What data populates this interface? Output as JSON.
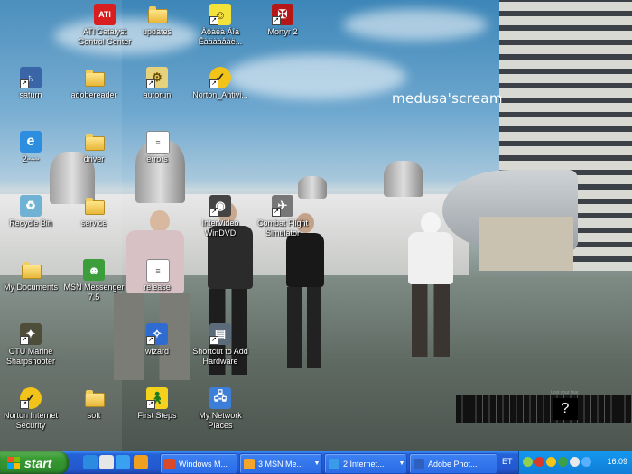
{
  "wallpaper": {
    "text": "medusa'scream",
    "badge": "?",
    "small_text": "Lost your fear"
  },
  "icons": [
    {
      "label": "ATI Catalyst Control Center",
      "icon": "ati-icon"
    },
    {
      "label": "updates",
      "icon": "folder-icon"
    },
    {
      "label": "Àôàéà Áîá Êàäààåàë...",
      "icon": "spongebob-icon"
    },
    {
      "label": "Mortyr 2",
      "icon": "mortyr-icon"
    },
    {
      "label": "saturn",
      "icon": "saturn-icon"
    },
    {
      "label": "adobereader",
      "icon": "folder-icon"
    },
    {
      "label": "autorun",
      "icon": "autorun-icon"
    },
    {
      "label": "Norton_Antivi...",
      "icon": "norton-icon"
    },
    {
      "label": "2ᵕᵕᵕᵕ",
      "icon": "ie-icon"
    },
    {
      "label": "driver",
      "icon": "folder-icon"
    },
    {
      "label": "errors",
      "icon": "text-file-icon"
    },
    {
      "label": "Recycle Bin",
      "icon": "recycle-bin-icon"
    },
    {
      "label": "service",
      "icon": "folder-icon"
    },
    {
      "label": "InterVideo WinDVD",
      "icon": "windvd-icon"
    },
    {
      "label": "Combat Flight Simulator",
      "icon": "flight-sim-icon"
    },
    {
      "label": "My Documents",
      "icon": "my-documents-icon"
    },
    {
      "label": "MSN Messenger 7.5",
      "icon": "msn-icon"
    },
    {
      "label": "release",
      "icon": "text-file-icon"
    },
    {
      "label": "CTU Marine Sharpshooter",
      "icon": "game-icon"
    },
    {
      "label": "wizard",
      "icon": "wizard-icon"
    },
    {
      "label": "Shortcut to Add Hardware",
      "icon": "add-hardware-icon"
    },
    {
      "label": "Norton Internet Security",
      "icon": "norton-icon"
    },
    {
      "label": "soft",
      "icon": "folder-icon"
    },
    {
      "label": "First Steps",
      "icon": "first-steps-icon"
    },
    {
      "label": "My Network Places",
      "icon": "network-places-icon"
    }
  ],
  "taskbar": {
    "start_label": "start",
    "tasks": [
      {
        "label": "Windows M...",
        "icon": "media-player-icon",
        "color": "#d94a2b"
      },
      {
        "label": "3 MSN Me...",
        "icon": "msn-icon",
        "color": "#f4a52b"
      },
      {
        "label": "2 Internet...",
        "icon": "ie-icon",
        "color": "#3a9be8"
      },
      {
        "label": "Adobe Phot...",
        "icon": "photoshop-icon",
        "color": "#2f5fbf"
      }
    ],
    "language": "ET",
    "clock": "16:09"
  },
  "colors": {
    "taskbar": "#2457cf",
    "start": "#389b33",
    "tray": "#0f7ed8"
  }
}
